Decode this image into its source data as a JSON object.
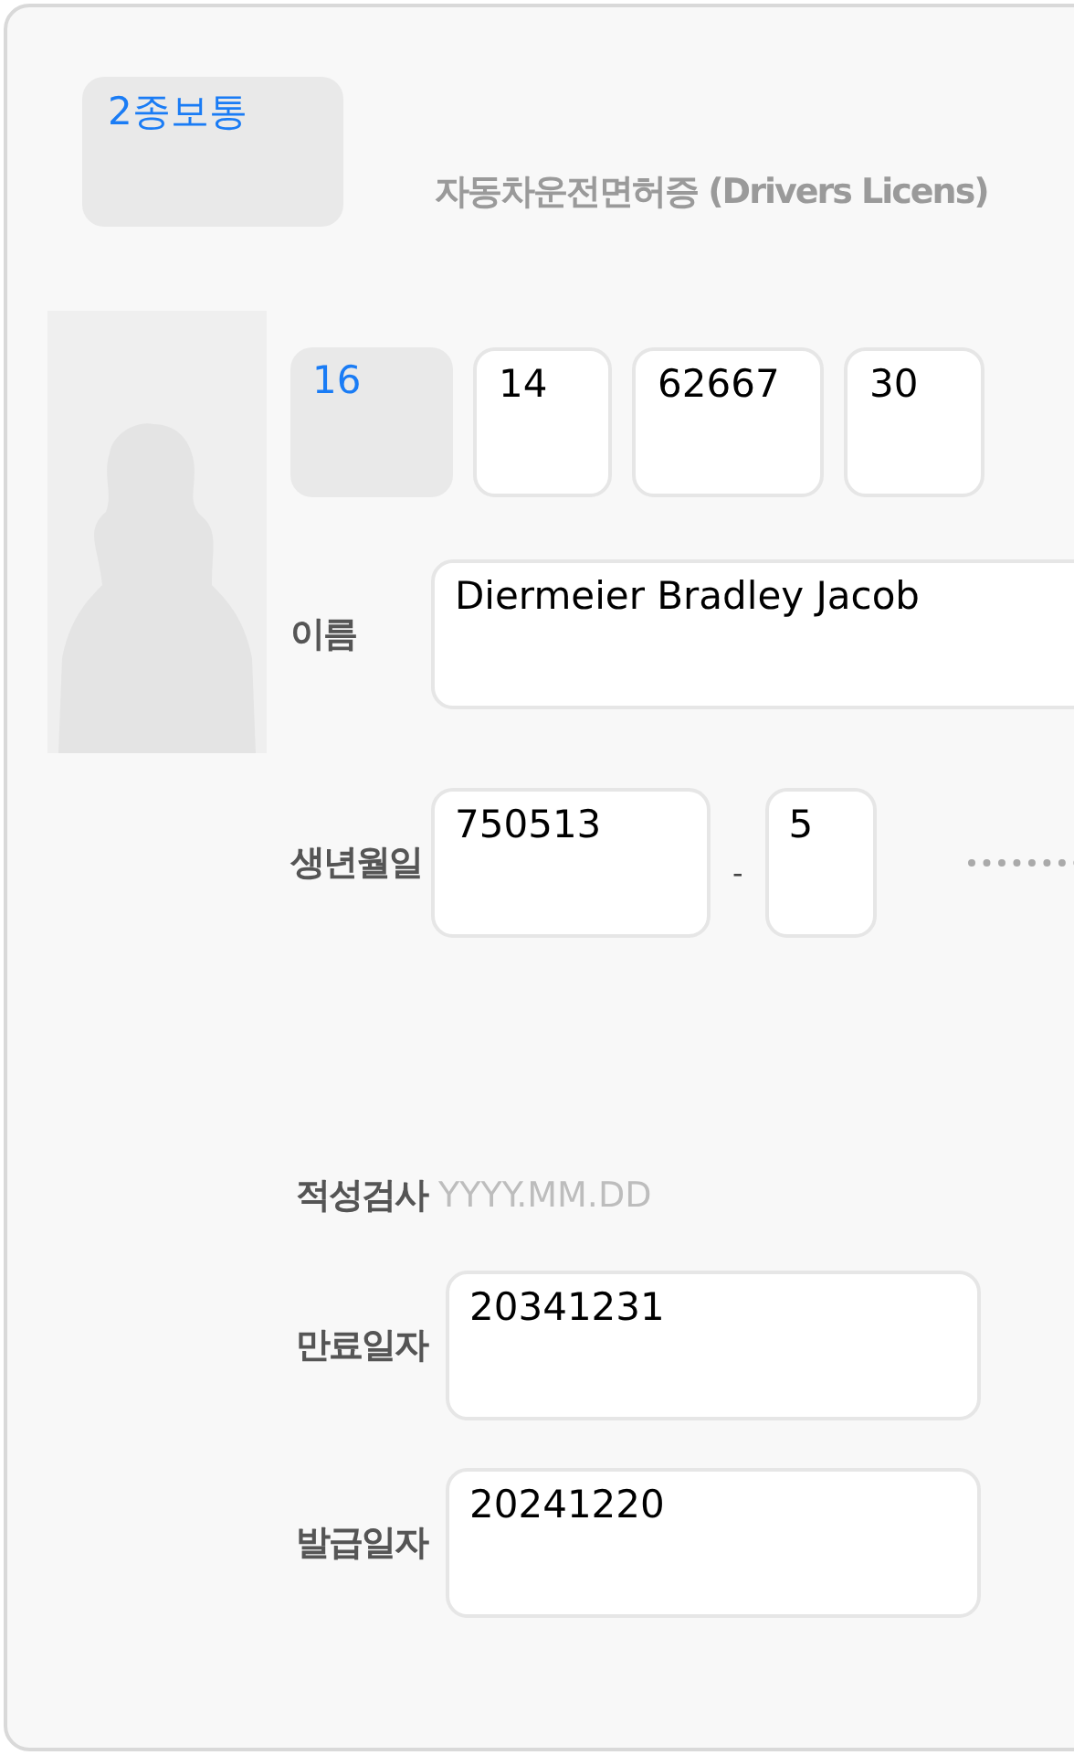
{
  "license_type": {
    "value": "2종보통"
  },
  "title": "자동차운전면허증 (Drivers Licens)",
  "license_number": [
    {
      "value": "16",
      "kind": "fixed"
    },
    {
      "value": "14",
      "kind": "input"
    },
    {
      "value": "62667",
      "kind": "input"
    },
    {
      "value": "30",
      "kind": "input"
    }
  ],
  "name": {
    "label": "이름",
    "value": "Diermeier Bradley Jacob"
  },
  "birth": {
    "label": "생년월일",
    "value": "750513",
    "separator": "-",
    "gender_digit": "5"
  },
  "aptitude_test": {
    "label": "적성검사",
    "placeholder": "YYYY.MM.DD"
  },
  "expiry_date": {
    "label": "만료일자",
    "value": "20341231"
  },
  "issue_date": {
    "label": "발급일자",
    "value": "20241220"
  }
}
